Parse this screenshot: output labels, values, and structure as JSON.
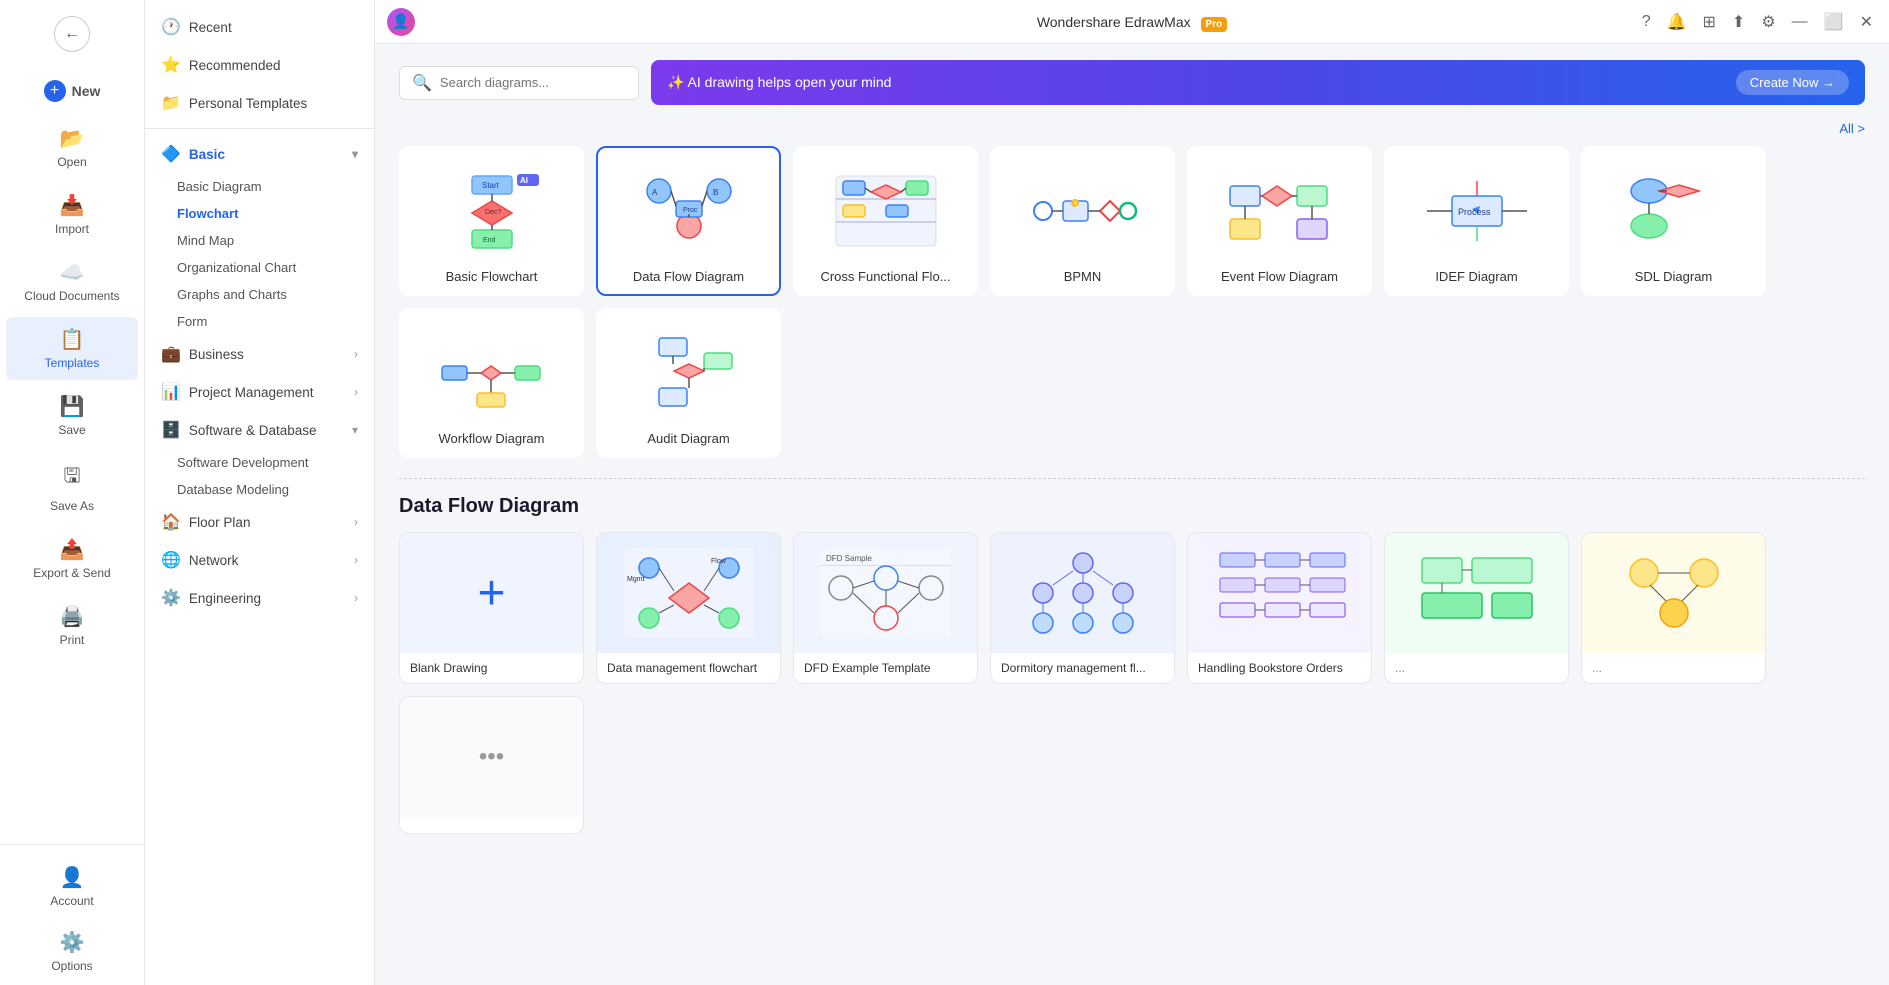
{
  "titlebar": {
    "app_name": "Wondershare EdrawMax",
    "pro_label": "Pro"
  },
  "sidebar_left": {
    "nav_items": [
      {
        "id": "new",
        "label": "New",
        "icon": "🆕",
        "has_plus": true
      },
      {
        "id": "open",
        "label": "Open",
        "icon": "📂"
      },
      {
        "id": "import",
        "label": "Import",
        "icon": "📥"
      },
      {
        "id": "cloud",
        "label": "Cloud Documents",
        "icon": "☁️"
      },
      {
        "id": "templates",
        "label": "Templates",
        "icon": "📋",
        "active": true
      },
      {
        "id": "save",
        "label": "Save",
        "icon": "💾"
      },
      {
        "id": "save_as",
        "label": "Save As",
        "icon": "💾"
      },
      {
        "id": "export",
        "label": "Export & Send",
        "icon": "📤"
      },
      {
        "id": "print",
        "label": "Print",
        "icon": "🖨️"
      }
    ],
    "bottom_items": [
      {
        "id": "account",
        "label": "Account",
        "icon": "👤"
      },
      {
        "id": "options",
        "label": "Options",
        "icon": "⚙️"
      }
    ]
  },
  "sidebar_second": {
    "top_items": [
      {
        "id": "recent",
        "label": "Recent",
        "icon": "🕐"
      },
      {
        "id": "recommended",
        "label": "Recommended",
        "icon": "⭐"
      },
      {
        "id": "personal",
        "label": "Personal Templates",
        "icon": "📁"
      }
    ],
    "categories": [
      {
        "id": "basic",
        "label": "Basic",
        "icon": "🔷",
        "expanded": true,
        "sub_items": [
          {
            "id": "basic_diagram",
            "label": "Basic Diagram"
          },
          {
            "id": "flowchart",
            "label": "Flowchart",
            "active": true
          },
          {
            "id": "mind_map",
            "label": "Mind Map"
          },
          {
            "id": "org_chart",
            "label": "Organizational Chart"
          },
          {
            "id": "graphs_charts",
            "label": "Graphs and Charts"
          },
          {
            "id": "form",
            "label": "Form"
          }
        ]
      },
      {
        "id": "business",
        "label": "Business",
        "icon": "💼",
        "has_chevron": true
      },
      {
        "id": "project_mgmt",
        "label": "Project Management",
        "icon": "📊",
        "has_chevron": true
      },
      {
        "id": "software_db",
        "label": "Software & Database",
        "icon": "🗄️",
        "expanded": true,
        "sub_items": [
          {
            "id": "software_dev",
            "label": "Software Development"
          },
          {
            "id": "db_modeling",
            "label": "Database Modeling"
          }
        ]
      },
      {
        "id": "floor_plan",
        "label": "Floor Plan",
        "icon": "🏠",
        "has_chevron": true
      },
      {
        "id": "network",
        "label": "Network",
        "icon": "🌐",
        "has_chevron": true
      },
      {
        "id": "engineering",
        "label": "Engineering",
        "icon": "⚙️",
        "has_chevron": true
      }
    ]
  },
  "search": {
    "placeholder": "Search diagrams..."
  },
  "ai_banner": {
    "text": "✨ AI drawing helps open your mind",
    "cta": "Create Now →"
  },
  "all_link": "All >",
  "diagram_types": [
    {
      "id": "basic_flowchart",
      "label": "Basic Flowchart",
      "selected": false
    },
    {
      "id": "data_flow",
      "label": "Data Flow Diagram",
      "selected": true
    },
    {
      "id": "cross_functional",
      "label": "Cross Functional Flo...",
      "selected": false
    },
    {
      "id": "bpmn",
      "label": "BPMN",
      "selected": false
    },
    {
      "id": "event_flow",
      "label": "Event Flow Diagram",
      "selected": false
    },
    {
      "id": "idef",
      "label": "IDEF Diagram",
      "selected": false
    },
    {
      "id": "sdl",
      "label": "SDL Diagram",
      "selected": false
    },
    {
      "id": "workflow",
      "label": "Workflow Diagram",
      "selected": false
    },
    {
      "id": "audit",
      "label": "Audit Diagram",
      "selected": false
    }
  ],
  "section_title": "Data Flow Diagram",
  "templates": [
    {
      "id": "blank",
      "label": "Blank Drawing",
      "type": "blank"
    },
    {
      "id": "data_mgmt",
      "label": "Data management flowchart",
      "type": "template"
    },
    {
      "id": "dfd_example",
      "label": "DFD Example Template",
      "type": "template"
    },
    {
      "id": "dormitory",
      "label": "Dormitory management fl...",
      "type": "template"
    },
    {
      "id": "bookstore",
      "label": "Handling Bookstore Orders",
      "type": "template"
    },
    {
      "id": "more1",
      "label": "...",
      "type": "template"
    },
    {
      "id": "more2",
      "label": "...",
      "type": "template"
    },
    {
      "id": "more3",
      "label": "...",
      "type": "more"
    }
  ]
}
